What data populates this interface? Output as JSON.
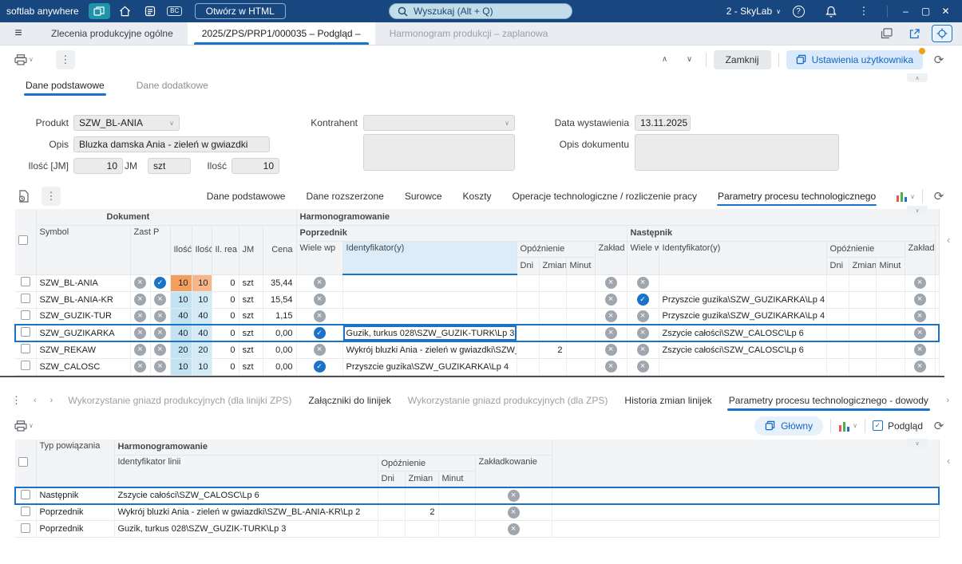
{
  "topbar": {
    "app_name": "softlab anywhere",
    "bc_label": "BC",
    "open_html_label": "Otwórz w HTML",
    "search_placeholder": "Wyszukaj (Alt + Q)",
    "user_label": "2 - SkyLab"
  },
  "tabstrip": {
    "tab_orders": "Zlecenia produkcyjne ogólne",
    "tab_document": "2025/ZPS/PRP1/000035 – Podgląd –",
    "tab_schedule": "Harmonogram produkcji – zaplanowa"
  },
  "toolbar": {
    "close_label": "Zamknij",
    "settings_label": "Ustawienia użytkownika"
  },
  "form_tabs": {
    "basic": "Dane podstawowe",
    "additional": "Dane dodatkowe"
  },
  "form": {
    "produkt_label": "Produkt",
    "produkt_value": "SZW_BL-ANIA",
    "opis_label": "Opis",
    "opis_value": "Bluzka damska Ania - zieleń w gwiazdki",
    "ilosc_jm_label": "Ilość [JM]",
    "ilosc_jm_value": "10",
    "jm_label": "JM",
    "jm_value": "szt",
    "ilosc_label": "Ilość",
    "ilosc_value": "10",
    "kontrahent_label": "Kontrahent",
    "data_label": "Data wystawienia",
    "data_value": "13.11.2025",
    "opis_dokumentu_label": "Opis dokumentu"
  },
  "grid_tabs": {
    "t1": "Dane podstawowe",
    "t2": "Dane rozszerzone",
    "t3": "Surowce",
    "t4": "Koszty",
    "t5": "Operacje technologiczne / rozliczenie pracy",
    "t6": "Parametry procesu technologicznego"
  },
  "main_grid": {
    "h_dokument": "Dokument",
    "h_harmonogramowanie": "Harmonogramowanie",
    "h_poprzednik": "Poprzednik",
    "h_nastepnik": "Następnik",
    "h_symbol": "Symbol",
    "h_zast_p": "Zast P",
    "h_ilosc": "Ilość",
    "h_ilosc2": "Ilość",
    "h_il_rea": "Il. rea",
    "h_jm": "JM",
    "h_cena": "Cena",
    "h_wiele_wp": "Wiele wp",
    "h_identyfikatory": "Identyfikator(y)",
    "h_opoznienie": "Opóźnienie",
    "h_dni": "Dni",
    "h_zmian": "Zmian",
    "h_minut": "Minut",
    "h_zaklad": "Zakład",
    "h_wiele_n": "Wiele w",
    "h_identyfikatory_n": "Identyfikator(y)",
    "h_opoznienie_n": "Opóźnienie",
    "h_zaklad_n": "Zakład",
    "rows": [
      {
        "symbol": "SZW_BL-ANIA",
        "zast": "x",
        "p": "check",
        "ilosc1": "10",
        "ilosc2": "10",
        "il_rea": "0",
        "jm": "szt",
        "cena": "35,44",
        "wiele_p": "x",
        "poprzednik": "",
        "p_dni": "",
        "p_zmian": "",
        "p_minut": "",
        "zaklad_p": "x",
        "wiele_n": "x",
        "nastepnik": "",
        "n_dni": "",
        "n_zmian": "",
        "n_minut": "",
        "zaklad_n": "x",
        "selected": false
      },
      {
        "symbol": "SZW_BL-ANIA-KR",
        "zast": "x",
        "p": "x",
        "ilosc1": "10",
        "ilosc2": "10",
        "il_rea": "0",
        "jm": "szt",
        "cena": "15,54",
        "wiele_p": "x",
        "poprzednik": "",
        "p_dni": "",
        "p_zmian": "",
        "p_minut": "",
        "zaklad_p": "x",
        "wiele_n": "check",
        "nastepnik": "Przyszcie guzika\\SZW_GUZIKARKA\\Lp 4",
        "n_dni": "",
        "n_zmian": "",
        "n_minut": "",
        "zaklad_n": "x",
        "selected": false
      },
      {
        "symbol": "SZW_GUZIK-TUR",
        "zast": "x",
        "p": "x",
        "ilosc1": "40",
        "ilosc2": "40",
        "il_rea": "0",
        "jm": "szt",
        "cena": "1,15",
        "wiele_p": "x",
        "poprzednik": "",
        "p_dni": "",
        "p_zmian": "",
        "p_minut": "",
        "zaklad_p": "x",
        "wiele_n": "x",
        "nastepnik": "Przyszcie guzika\\SZW_GUZIKARKA\\Lp 4",
        "n_dni": "",
        "n_zmian": "",
        "n_minut": "",
        "zaklad_n": "x",
        "selected": false
      },
      {
        "symbol": "SZW_GUZIKARKA",
        "zast": "x",
        "p": "x",
        "ilosc1": "40",
        "ilosc2": "40",
        "il_rea": "0",
        "jm": "szt",
        "cena": "0,00",
        "wiele_p": "check",
        "poprzednik": "Guzik, turkus 028\\SZW_GUZIK-TURK\\Lp 3",
        "p_dni": "",
        "p_zmian": "",
        "p_minut": "",
        "zaklad_p": "x",
        "wiele_n": "x",
        "nastepnik": "Zszycie całości\\SZW_CALOSC\\Lp 6",
        "n_dni": "",
        "n_zmian": "",
        "n_minut": "",
        "zaklad_n": "x",
        "selected": true
      },
      {
        "symbol": "SZW_REKAW",
        "zast": "x",
        "p": "x",
        "ilosc1": "20",
        "ilosc2": "20",
        "il_rea": "0",
        "jm": "szt",
        "cena": "0,00",
        "wiele_p": "x",
        "poprzednik": "Wykrój bluzki Ania - zieleń w gwiazdki\\SZW_",
        "p_dni": "",
        "p_zmian": "2",
        "p_minut": "",
        "zaklad_p": "x",
        "wiele_n": "x",
        "nastepnik": "Zszycie całości\\SZW_CALOSC\\Lp 6",
        "n_dni": "",
        "n_zmian": "",
        "n_minut": "",
        "zaklad_n": "x",
        "selected": false
      },
      {
        "symbol": "SZW_CALOSC",
        "zast": "x",
        "p": "x",
        "ilosc1": "10",
        "ilosc2": "10",
        "il_rea": "0",
        "jm": "szt",
        "cena": "0,00",
        "wiele_p": "check",
        "poprzednik": "Przyszcie guzika\\SZW_GUZIKARKA\\Lp 4",
        "p_dni": "",
        "p_zmian": "",
        "p_minut": "",
        "zaklad_p": "x",
        "wiele_n": "x",
        "nastepnik": "",
        "n_dni": "",
        "n_zmian": "",
        "n_minut": "",
        "zaklad_n": "x",
        "selected": false
      }
    ]
  },
  "bottom_tabs": {
    "t1": "Wykorzystanie gniazd produkcyjnych (dla linijki ZPS)",
    "t2": "Załączniki do linijek",
    "t3": "Wykorzystanie gniazd produkcyjnych (dla ZPS)",
    "t4": "Historia zmian linijek",
    "t5": "Parametry procesu technologicznego - dowody"
  },
  "bottom_toolbar": {
    "glowny_label": "Główny",
    "podglad_label": "Podgląd"
  },
  "bottom_grid": {
    "h_typ": "Typ powiązania",
    "h_harmonogramowanie": "Harmonogramowanie",
    "h_identyfikator": "Identyfikator linii",
    "h_opoznienie": "Opóźnienie",
    "h_dni": "Dni",
    "h_zmian": "Zmian",
    "h_minut": "Minut",
    "h_zakladkowanie": "Zakładkowanie",
    "rows": [
      {
        "typ": "Następnik",
        "identyfikator": "Zszycie całości\\SZW_CALOSC\\Lp 6",
        "dni": "",
        "zmian": "",
        "minut": "",
        "zakladkowanie": "x",
        "selected": true
      },
      {
        "typ": "Poprzednik",
        "identyfikator": "Wykrój bluzki Ania - zieleń w gwiazdki\\SZW_BL-ANIA-KR\\Lp 2",
        "dni": "",
        "zmian": "2",
        "minut": "",
        "zakladkowanie": "x",
        "selected": false
      },
      {
        "typ": "Poprzednik",
        "identyfikator": "Guzik, turkus 028\\SZW_GUZIK-TURK\\Lp 3",
        "dni": "",
        "zmian": "",
        "minut": "",
        "zakladkowanie": "x",
        "selected": false
      }
    ]
  }
}
